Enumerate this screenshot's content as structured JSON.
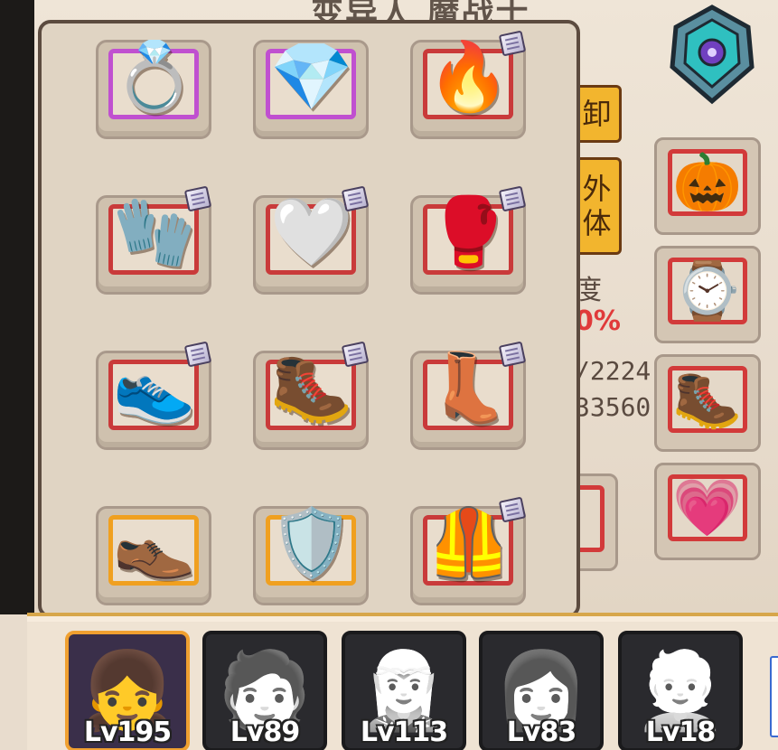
{
  "background": {
    "title_fragment": "变异人 魔战士",
    "buttons": {
      "unload": "卸",
      "appearance": "外\n体"
    },
    "stats": {
      "label": "度",
      "percent": "0%",
      "value_a": "/2224",
      "value_b": "33560"
    }
  },
  "equipment_grid": {
    "rows": [
      [
        {
          "name": "ring-purple",
          "icon": "💍",
          "frame": "purple",
          "tag": false
        },
        {
          "name": "ring-crystal",
          "icon": "💎",
          "frame": "purple",
          "tag": false
        },
        {
          "name": "ring-fire",
          "icon": "🔥",
          "frame": "red",
          "tag": true
        }
      ],
      [
        {
          "name": "gauntlet-golden",
          "icon": "🧤",
          "frame": "red",
          "tag": true
        },
        {
          "name": "glove-white-red",
          "icon": "🤍",
          "frame": "red",
          "tag": true
        },
        {
          "name": "gauntlet-dark",
          "icon": "🥊",
          "frame": "red",
          "tag": true
        }
      ],
      [
        {
          "name": "sneaker-brown",
          "icon": "👟",
          "frame": "red",
          "tag": true
        },
        {
          "name": "boots-red-claw",
          "icon": "🥾",
          "frame": "red",
          "tag": true
        },
        {
          "name": "boots-golden-wing",
          "icon": "👢",
          "frame": "red",
          "tag": true
        }
      ],
      [
        {
          "name": "boots-purple",
          "icon": "👞",
          "frame": "orange",
          "tag": false
        },
        {
          "name": "armor-golden",
          "icon": "🛡️",
          "frame": "orange",
          "tag": false
        },
        {
          "name": "armor-flame",
          "icon": "🦺",
          "frame": "red",
          "tag": true
        }
      ]
    ]
  },
  "right_column": [
    {
      "name": "pumpkin",
      "icon": "🎃"
    },
    {
      "name": "bracelet",
      "icon": "⌚"
    },
    {
      "name": "boots-steel",
      "icon": "🥾"
    },
    {
      "name": "heart-ring",
      "icon": "💗"
    }
  ],
  "heroes": [
    {
      "level": "Lv195",
      "portrait": "👧",
      "active": true
    },
    {
      "level": "Lv89",
      "portrait": "🧑",
      "active": false
    },
    {
      "level": "Lv113",
      "portrait": "🧝",
      "active": false
    },
    {
      "level": "Lv83",
      "portrait": "👩",
      "active": false
    },
    {
      "level": "Lv18",
      "portrait": "👱",
      "active": false
    }
  ],
  "colors": {
    "purple_frame": "#c050d0",
    "red_frame": "#c93a3a",
    "orange_frame": "#f0a020",
    "accent_button": "#f2b52e"
  }
}
